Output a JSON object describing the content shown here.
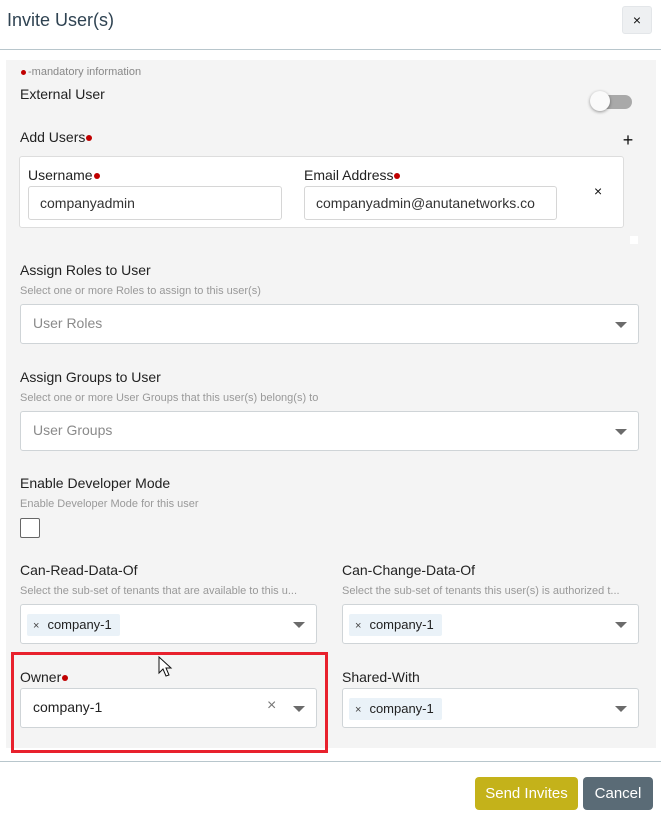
{
  "dialog": {
    "title": "Invite User(s)",
    "close_label": "×"
  },
  "form": {
    "mandatory_note": "-mandatory information",
    "external_user": {
      "label": "External User",
      "enabled": false
    },
    "add_users": {
      "label": "Add Users",
      "add_label": "+"
    },
    "user_row": {
      "username_label": "Username",
      "username_value": "companyadmin",
      "email_label": "Email Address",
      "email_value": "companyadmin@anutanetworks.co",
      "remove_label": "×"
    },
    "roles": {
      "label": "Assign Roles to User",
      "hint": "Select one or more Roles to assign to this user(s)",
      "placeholder": "User Roles"
    },
    "groups": {
      "label": "Assign Groups to User",
      "hint": "Select one or more User Groups that this user(s) belong(s) to",
      "placeholder": "User Groups"
    },
    "developer_mode": {
      "label": "Enable Developer Mode",
      "hint": "Enable Developer Mode for this user",
      "checked": false
    },
    "can_read": {
      "label": "Can-Read-Data-Of",
      "hint": "Select the sub-set of tenants that are available to this u...",
      "chip_remove": "×",
      "chip": "company-1"
    },
    "can_change": {
      "label": "Can-Change-Data-Of",
      "hint": "Select the sub-set of tenants this user(s) is authorized t...",
      "chip_remove": "×",
      "chip": "company-1"
    },
    "owner": {
      "label": "Owner",
      "value": "company-1",
      "clear_label": "×"
    },
    "shared_with": {
      "label": "Shared-With",
      "chip_remove": "×",
      "chip": "company-1"
    }
  },
  "footer": {
    "send_label": "Send Invites",
    "cancel_label": "Cancel"
  },
  "colors": {
    "send_button": "#c4b21a",
    "cancel_button": "#5a6b76",
    "required_marker": "#c00000",
    "highlight_box": "#e8212d",
    "chip_background": "#eaf2f8"
  },
  "icons": {
    "close": "close-icon",
    "add": "plus-icon",
    "remove": "remove-icon",
    "dropdown": "chevron-down-icon",
    "cursor": "mouse-pointer-icon"
  }
}
